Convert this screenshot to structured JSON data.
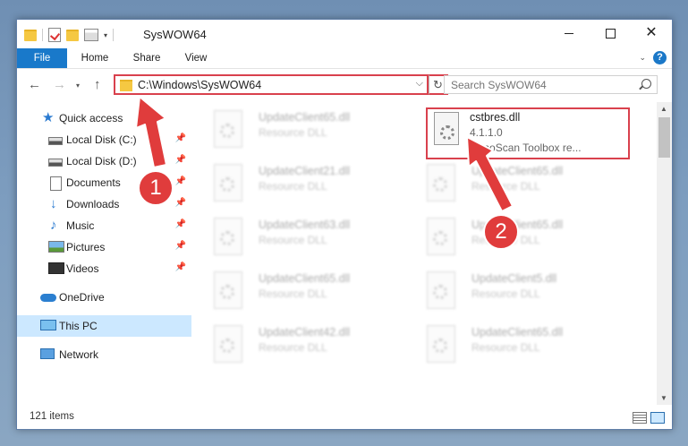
{
  "window": {
    "title": "SysWOW64"
  },
  "ribbon": {
    "tabs": [
      "File",
      "Home",
      "Share",
      "View"
    ]
  },
  "address": {
    "path": "C:\\Windows\\SysWOW64",
    "search_placeholder": "Search SysWOW64"
  },
  "sidebar": {
    "items": [
      {
        "label": "Quick access"
      },
      {
        "label": "Local Disk (C:)"
      },
      {
        "label": "Local Disk (D:)"
      },
      {
        "label": "Documents"
      },
      {
        "label": "Downloads"
      },
      {
        "label": "Music"
      },
      {
        "label": "Pictures"
      },
      {
        "label": "Videos"
      },
      {
        "label": "OneDrive"
      },
      {
        "label": "This PC"
      },
      {
        "label": "Network"
      }
    ]
  },
  "files": {
    "left": [
      {
        "name": "UpdateClient65.dll",
        "type": "Resource DLL"
      },
      {
        "name": "UpdateClient21.dll",
        "type": "Resource DLL"
      },
      {
        "name": "UpdateClient63.dll",
        "type": "Resource DLL"
      },
      {
        "name": "UpdateClient65.dll",
        "type": "Resource DLL"
      },
      {
        "name": "UpdateClient42.dll",
        "type": "Resource DLL"
      }
    ],
    "right": [
      {
        "name": "cstbres.dll",
        "version": "4.1.1.0",
        "description": "CanoScan Toolbox re..."
      },
      {
        "name": "UpdateClient65.dll",
        "type": "Resource DLL"
      },
      {
        "name": "UpdateClient65.dll",
        "type": "Resource DLL"
      },
      {
        "name": "UpdateClient5.dll",
        "type": "Resource DLL"
      },
      {
        "name": "UpdateClient65.dll",
        "type": "Resource DLL"
      }
    ]
  },
  "status": {
    "item_count": "121 items"
  },
  "callouts": {
    "one": "1",
    "two": "2"
  },
  "colors": {
    "accent": "#1979ca",
    "highlight": "#d9414d"
  }
}
